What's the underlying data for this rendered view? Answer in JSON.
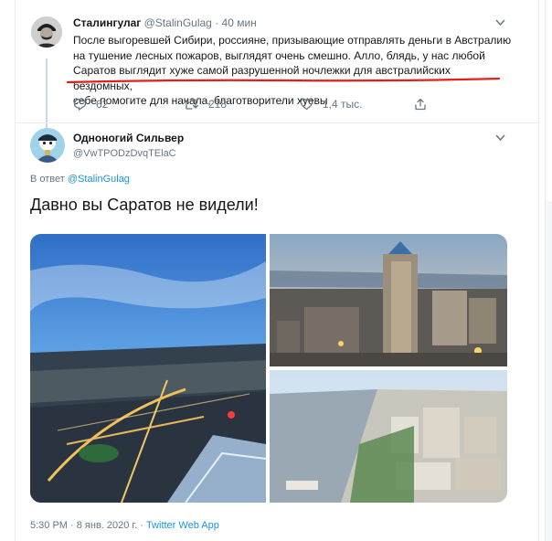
{
  "parent_tweet": {
    "display_name": "Сталингулаг",
    "handle": "@StalinGulag",
    "separator": "·",
    "time": "40 мин",
    "text_lines": [
      "После выгоревшей Сибири, россияне, призывающие отправлять деньги в Австралию",
      "на тушение лесных пожаров, выглядят очень смешно. Алло, блядь, у нас любой",
      "Саратов выглядит хуже самой разрушенной ночлежки для австралийских бездомных,",
      "себе помогите для начала, благотворители хуевы"
    ],
    "reply_count": "62",
    "retweet_count": "218",
    "like_count": "1,4 тыс."
  },
  "main_tweet": {
    "display_name": "Одноногий Сильвер",
    "handle": "@VwTPODzDvqTElaC",
    "reply_prefix": "В ответ",
    "reply_to": "@StalinGulag",
    "text": "Давно вы Саратов не видели!",
    "timestamp": "5:30 PM · 8 янв. 2020 г.",
    "footer_sep": " · ",
    "source": "Twitter Web App"
  },
  "colors": {
    "accent": "#1b95e0",
    "secondary_text": "#657786",
    "annotation_red": "#e0201a"
  },
  "icons": [
    "caret-down-icon",
    "reply-icon",
    "retweet-icon",
    "like-icon",
    "share-icon"
  ]
}
